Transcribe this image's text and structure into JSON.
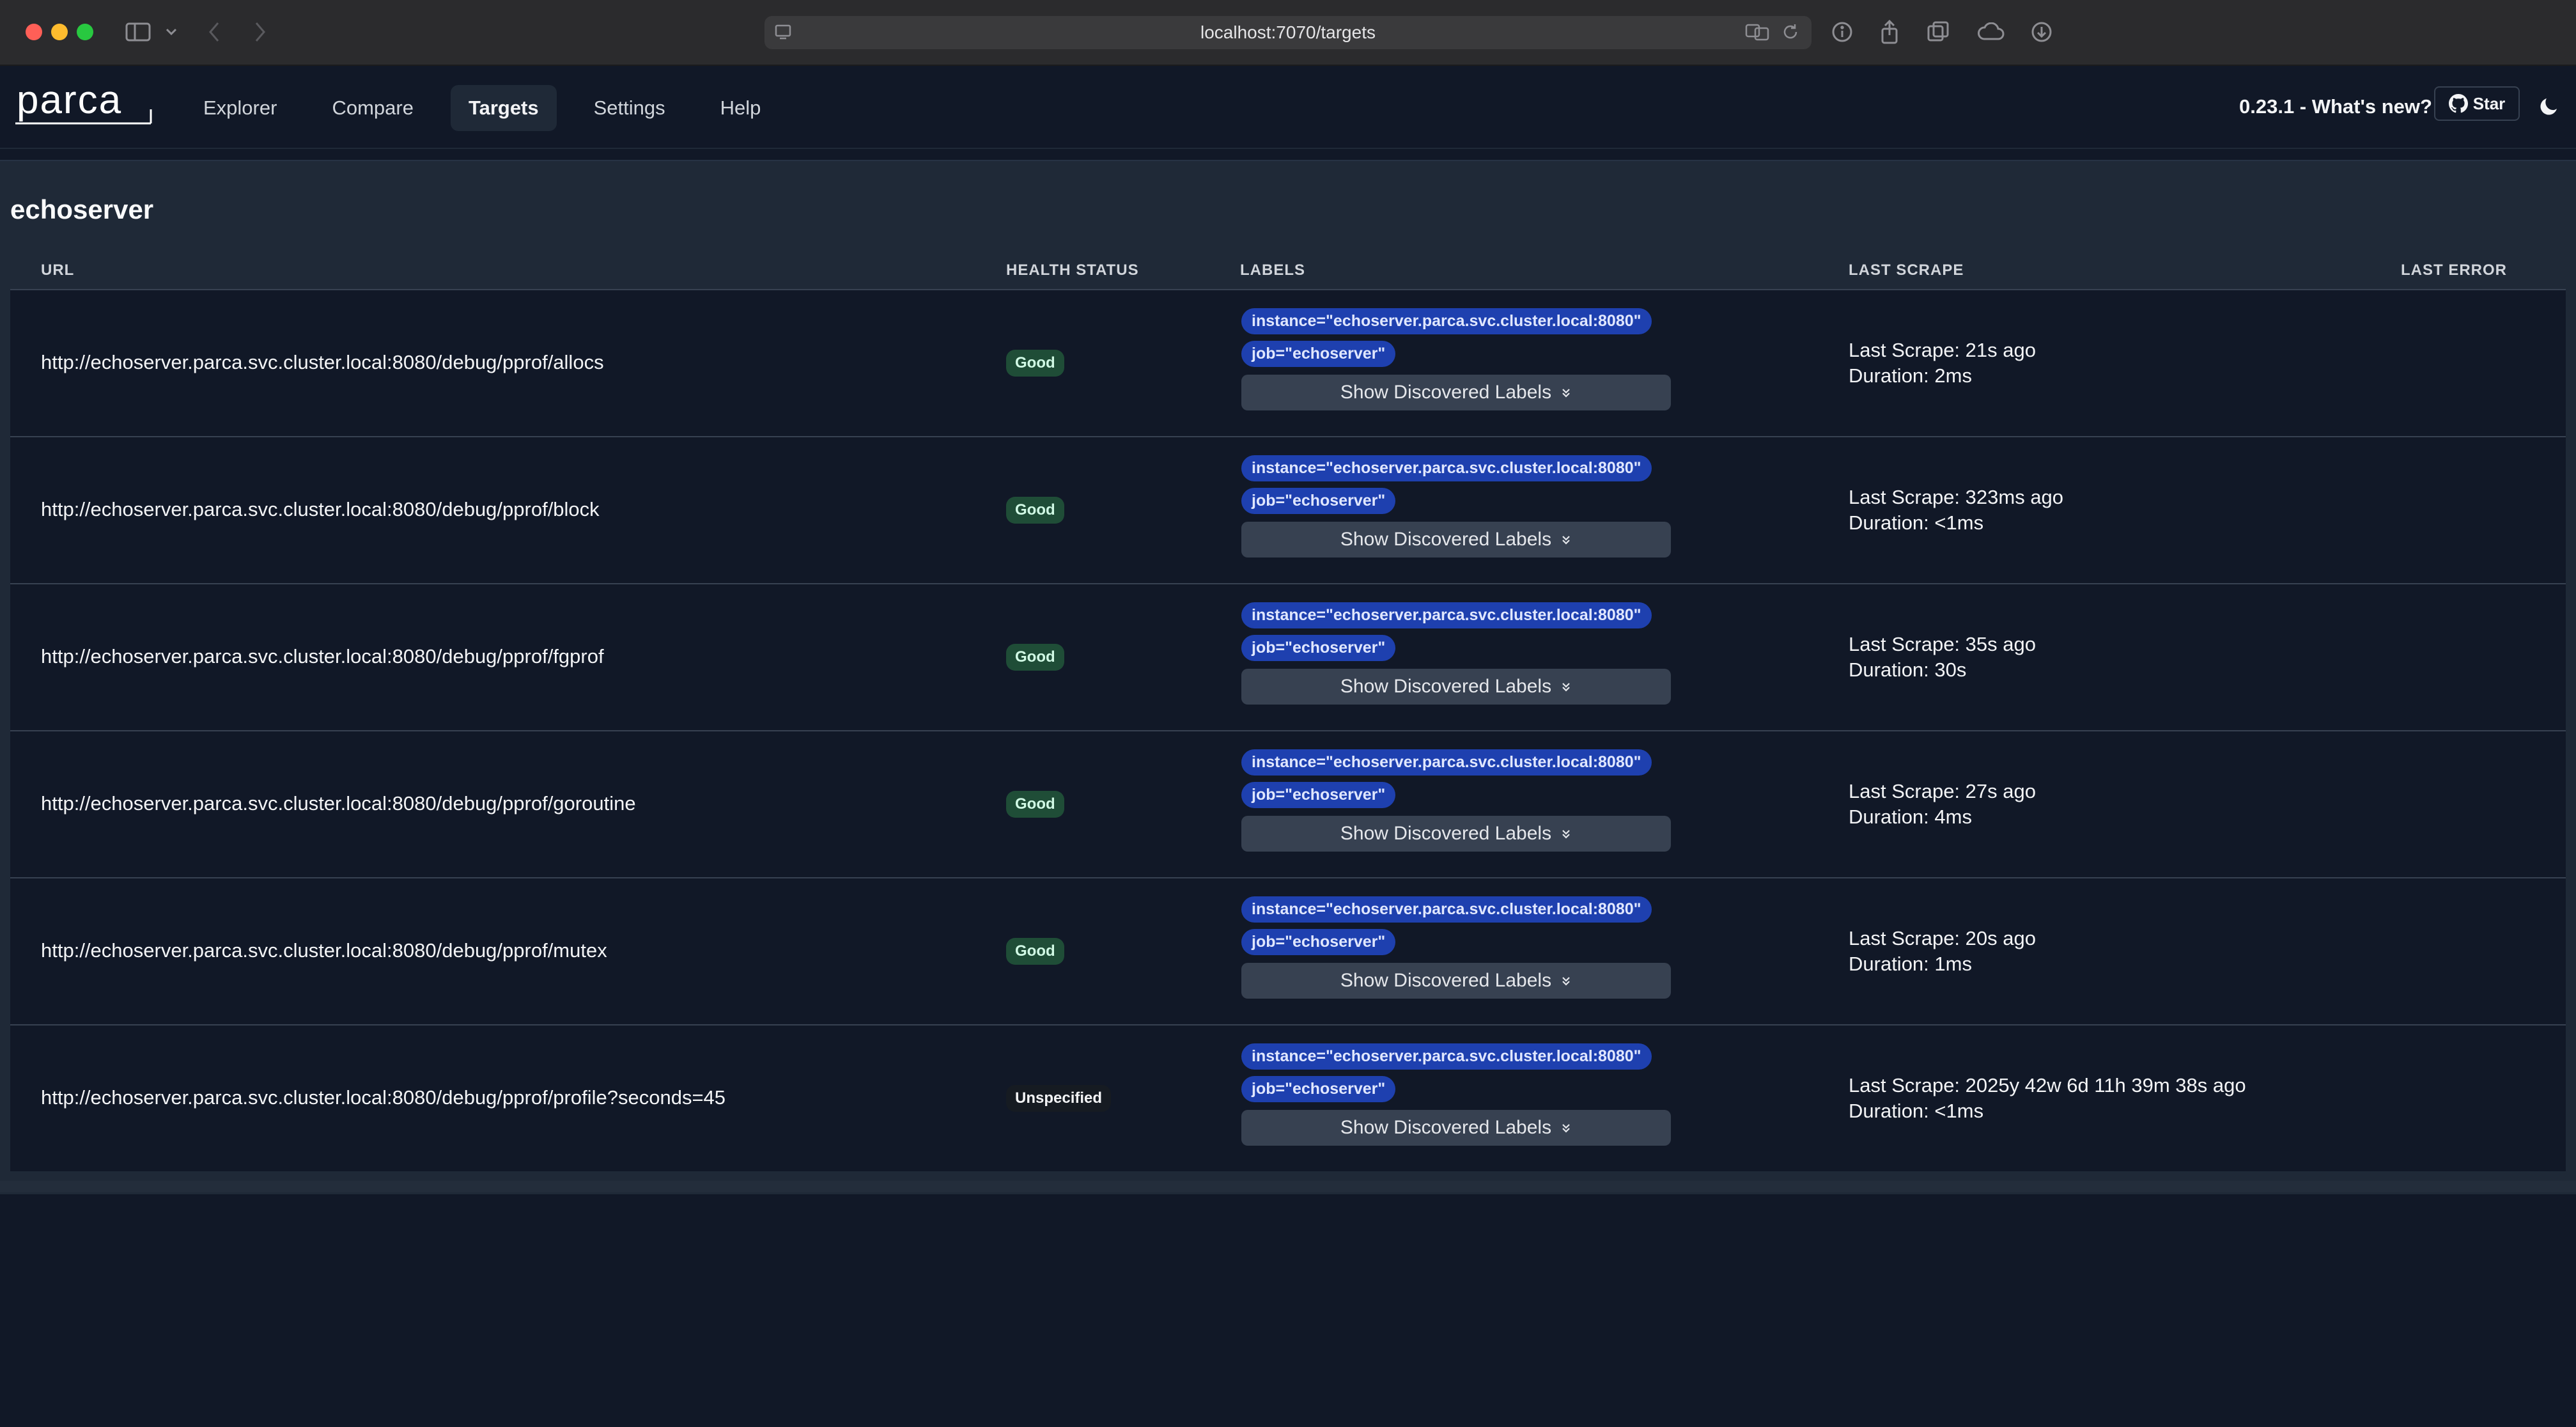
{
  "browser": {
    "url": "localhost:7070/targets"
  },
  "app": {
    "logo_text": "parca",
    "nav": [
      {
        "label": "Explorer"
      },
      {
        "label": "Compare"
      },
      {
        "label": "Targets",
        "active": true
      },
      {
        "label": "Settings"
      },
      {
        "label": "Help"
      }
    ],
    "version_text": "0.23.1 - What's new?",
    "star_label": "Star"
  },
  "job": {
    "name": "echoserver",
    "columns": {
      "url": "URL",
      "health": "HEALTH STATUS",
      "labels": "LABELS",
      "last_scrape": "LAST SCRAPE",
      "last_error": "LAST ERROR"
    },
    "show_labels_text": "Show Discovered Labels",
    "targets": [
      {
        "url": "http://echoserver.parca.svc.cluster.local:8080/debug/pprof/allocs",
        "health": "Good",
        "labels": [
          "instance=\"echoserver.parca.svc.cluster.local:8080\"",
          "job=\"echoserver\""
        ],
        "last_scrape": "Last Scrape: 21s ago",
        "duration": "Duration: 2ms"
      },
      {
        "url": "http://echoserver.parca.svc.cluster.local:8080/debug/pprof/block",
        "health": "Good",
        "labels": [
          "instance=\"echoserver.parca.svc.cluster.local:8080\"",
          "job=\"echoserver\""
        ],
        "last_scrape": "Last Scrape: 323ms ago",
        "duration": "Duration: <1ms"
      },
      {
        "url": "http://echoserver.parca.svc.cluster.local:8080/debug/pprof/fgprof",
        "health": "Good",
        "labels": [
          "instance=\"echoserver.parca.svc.cluster.local:8080\"",
          "job=\"echoserver\""
        ],
        "last_scrape": "Last Scrape: 35s ago",
        "duration": "Duration: 30s"
      },
      {
        "url": "http://echoserver.parca.svc.cluster.local:8080/debug/pprof/goroutine",
        "health": "Good",
        "labels": [
          "instance=\"echoserver.parca.svc.cluster.local:8080\"",
          "job=\"echoserver\""
        ],
        "last_scrape": "Last Scrape: 27s ago",
        "duration": "Duration: 4ms"
      },
      {
        "url": "http://echoserver.parca.svc.cluster.local:8080/debug/pprof/mutex",
        "health": "Good",
        "labels": [
          "instance=\"echoserver.parca.svc.cluster.local:8080\"",
          "job=\"echoserver\""
        ],
        "last_scrape": "Last Scrape: 20s ago",
        "duration": "Duration: 1ms"
      },
      {
        "url": "http://echoserver.parca.svc.cluster.local:8080/debug/pprof/profile?seconds=45",
        "health": "Unspecified",
        "labels": [
          "instance=\"echoserver.parca.svc.cluster.local:8080\"",
          "job=\"echoserver\""
        ],
        "last_scrape": "Last Scrape: 2025y 42w 6d 11h 39m 38s ago",
        "duration": "Duration: <1ms"
      }
    ]
  },
  "colors": {
    "background": "#111827",
    "panel": "#1f2937",
    "label_pill": "#1e40af",
    "good_badge": "#1f4d37"
  }
}
